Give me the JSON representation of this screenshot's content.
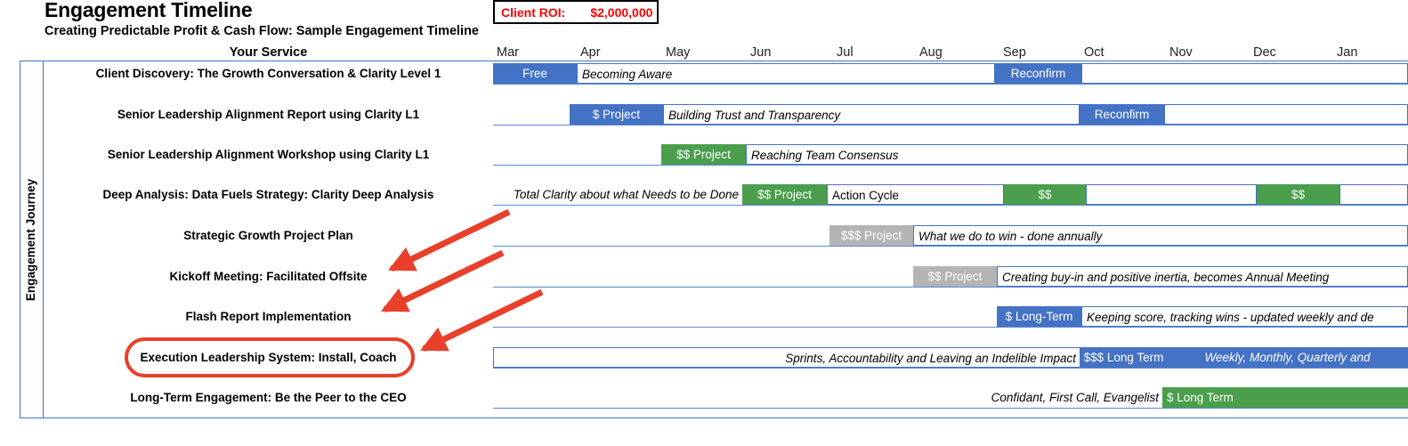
{
  "header": {
    "title": "Engagement Timeline",
    "subtitle": "Creating Predictable Profit & Cash Flow: Sample Engagement Timeline",
    "service_column_header": "Your Service",
    "roi_label": "Client ROI:",
    "roi_value": "$2,000,000",
    "roi_color": "#ff0000"
  },
  "axis": {
    "months": [
      "Mar",
      "Apr",
      "May",
      "Jun",
      "Jul",
      "Aug",
      "Sep",
      "Oct",
      "Nov",
      "Dec",
      "Jan"
    ]
  },
  "sidebar": {
    "vertical_label": "Engagement Journey"
  },
  "colors": {
    "blue": "#4472c4",
    "green": "#4a9e4c",
    "gray": "#b4b4b4",
    "annotation_red": "#e8402a",
    "grid_line": "#5b8ad0"
  },
  "rows": [
    {
      "label": "Client Discovery: The Growth Conversation & Clarity Level 1",
      "bars": [
        {
          "text": "Free",
          "style": "blue",
          "align": "center",
          "italic": false
        },
        {
          "text": "Becoming Aware",
          "style": "white",
          "align": "left",
          "italic": true
        },
        {
          "text": "Reconfirm",
          "style": "blue",
          "align": "center",
          "italic": false
        },
        {
          "text": "",
          "style": "white",
          "align": "left",
          "italic": false
        }
      ]
    },
    {
      "label": "Senior Leadership Alignment Report using Clarity L1",
      "bars": [
        {
          "text": "$ Project",
          "style": "blue",
          "align": "center",
          "italic": false
        },
        {
          "text": "Building Trust and Transparency",
          "style": "white",
          "align": "left",
          "italic": true
        },
        {
          "text": "Reconfirm",
          "style": "blue",
          "align": "center",
          "italic": false
        },
        {
          "text": "",
          "style": "white",
          "align": "left",
          "italic": false
        }
      ]
    },
    {
      "label": "Senior Leadership Alignment Workshop using Clarity L1",
      "bars": [
        {
          "text": "$$ Project",
          "style": "green",
          "align": "center",
          "italic": false
        },
        {
          "text": "Reaching Team Consensus",
          "style": "white",
          "align": "left",
          "italic": true
        }
      ]
    },
    {
      "label": "Deep Analysis: Data Fuels Strategy: Clarity Deep Analysis",
      "bars": [
        {
          "text": "Total Clarity about what Needs to be Done",
          "style": "plain",
          "align": "right",
          "italic": true
        },
        {
          "text": "$$ Project",
          "style": "green",
          "align": "center",
          "italic": false
        },
        {
          "text": "Action Cycle",
          "style": "white",
          "align": "left",
          "italic": false
        },
        {
          "text": "$$",
          "style": "green",
          "align": "center",
          "italic": false
        },
        {
          "text": "",
          "style": "white",
          "align": "left",
          "italic": false
        },
        {
          "text": "$$",
          "style": "green",
          "align": "center",
          "italic": false
        },
        {
          "text": "",
          "style": "white",
          "align": "left",
          "italic": false
        }
      ]
    },
    {
      "label": "Strategic Growth Project Plan",
      "bars": [
        {
          "text": "$$$ Project",
          "style": "gray",
          "align": "center",
          "italic": false
        },
        {
          "text": "What we do to win - done annually",
          "style": "white",
          "align": "left",
          "italic": true
        }
      ]
    },
    {
      "label": "Kickoff Meeting: Facilitated Offsite",
      "bars": [
        {
          "text": "$$ Project",
          "style": "gray",
          "align": "center",
          "italic": false
        },
        {
          "text": "Creating buy-in and positive inertia, becomes Annual Meeting",
          "style": "white",
          "align": "left",
          "italic": true
        }
      ]
    },
    {
      "label": "Flash Report Implementation",
      "bars": [
        {
          "text": "$ Long-Term",
          "style": "blue",
          "align": "center",
          "italic": false
        },
        {
          "text": "Keeping score, tracking wins - updated weekly and de",
          "style": "white",
          "align": "left",
          "italic": true
        }
      ]
    },
    {
      "label": "Execution Leadership System: Install, Coach",
      "highlighted": true,
      "bars": [
        {
          "text": "Sprints, Accountability and Leaving an Indelible Impact",
          "style": "white",
          "align": "right",
          "italic": true
        },
        {
          "text": "$$$ Long Term",
          "style": "blue",
          "align": "center",
          "italic": false
        },
        {
          "text": "Weekly,  Monthly, Quarterly and",
          "style": "blue",
          "align": "center",
          "italic": true
        }
      ]
    },
    {
      "label": "Long-Term Engagement: Be the Peer to the CEO",
      "bars": [
        {
          "text": "Confidant, First Call, Evangelist",
          "style": "plain",
          "align": "right",
          "italic": true
        },
        {
          "text": "$ Long Term",
          "style": "green",
          "align": "left",
          "italic": false
        }
      ]
    }
  ],
  "annotations": {
    "arrow_count": 3,
    "arrow_color": "#e8402a",
    "highlight_shape": "rounded-rectangle",
    "highlight_target": "Execution Leadership System: Install, Coach"
  }
}
